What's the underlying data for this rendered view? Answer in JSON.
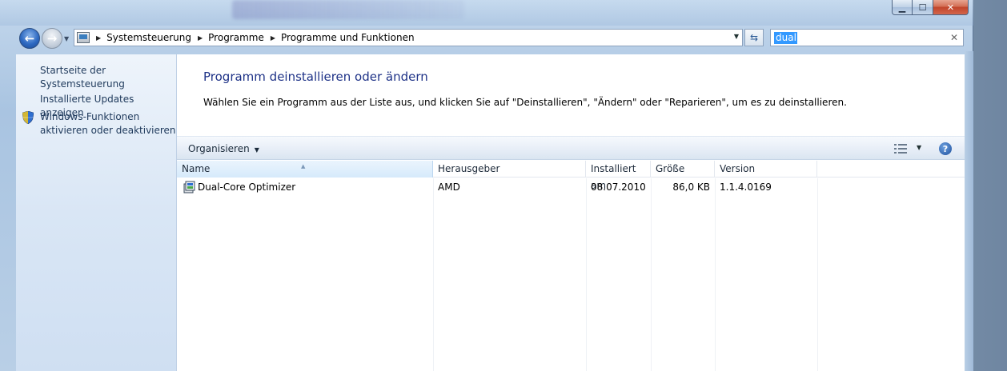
{
  "window": {
    "caption_buttons": {
      "minimize": "▁",
      "maximize": "☐",
      "close": "✕"
    }
  },
  "navbar": {
    "breadcrumbs": [
      "Systemsteuerung",
      "Programme",
      "Programme und Funktionen"
    ],
    "search_value": "dual"
  },
  "sidebar": {
    "items": [
      {
        "label": "Startseite der Systemsteuerung",
        "icon": null
      },
      {
        "label": "Installierte Updates anzeigen",
        "icon": null
      },
      {
        "label_line1": "Windows-Funktionen",
        "label_line2": "aktivieren oder deaktivieren",
        "icon": "shield-icon"
      }
    ]
  },
  "content": {
    "title": "Programm deinstallieren oder ändern",
    "description": "Wählen Sie ein Programm aus der Liste aus, und klicken Sie auf \"Deinstallieren\", \"Ändern\" oder \"Reparieren\", um es zu deinstallieren.",
    "toolbar": {
      "organize_label": "Organisieren",
      "help": "?"
    },
    "columns": [
      "Name",
      "Herausgeber",
      "Installiert am",
      "Größe",
      "Version"
    ],
    "rows": [
      {
        "name": "Dual-Core Optimizer",
        "publisher": "AMD",
        "installed": "08.07.2010",
        "size": "86,0 KB",
        "version": "1.1.4.0169"
      }
    ]
  },
  "colors": {
    "title_blue": "#1e3287",
    "link_blue": "#1e395b",
    "selection": "#3399ff"
  }
}
